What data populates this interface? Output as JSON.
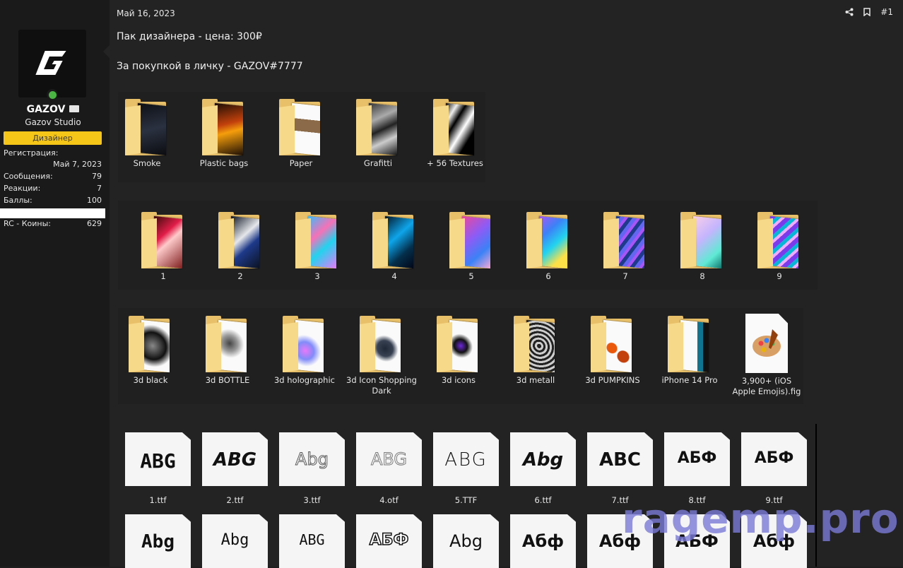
{
  "user": {
    "name": "GAZOV",
    "studio": "Gazov Studio",
    "role": "Дизайнер",
    "stats": [
      {
        "label": "Регистрация:",
        "value": "Май 7, 2023"
      },
      {
        "label": "Сообщения:",
        "value": "79"
      },
      {
        "label": "Реакции:",
        "value": "7"
      },
      {
        "label": "Баллы:",
        "value": "100"
      },
      {
        "label": "RC - Коины:",
        "value": "629"
      }
    ]
  },
  "post": {
    "date": "Май 16, 2023",
    "number": "#1",
    "line1": "Пак дизайнера - цена: 300₽",
    "line2": "За покупкой в личку - GAZOV#7777"
  },
  "textures": [
    "Smoke",
    "Plastic bags",
    "Paper",
    "Grafitti",
    "+ 56 Textures"
  ],
  "gradients": [
    "1",
    "2",
    "3",
    "4",
    "5",
    "6",
    "7",
    "8",
    "9"
  ],
  "icons3d": [
    "3d black",
    "3d BOTTLE",
    "3d holographic",
    "3d Icon Shopping Dark",
    "3d icons",
    "3d metall",
    "3d PUMPKINS",
    "iPhone 14 Pro",
    "3,900+ (iOS Apple Emojis).fig"
  ],
  "fonts_row1": [
    {
      "name": "1.ttf",
      "sample": "ABG"
    },
    {
      "name": "2.ttf",
      "sample": "ABG"
    },
    {
      "name": "3.ttf",
      "sample": "Abg"
    },
    {
      "name": "4.otf",
      "sample": "ABG"
    },
    {
      "name": "5.TTF",
      "sample": "ABG"
    },
    {
      "name": "6.ttf",
      "sample": "Abg"
    },
    {
      "name": "7.ttf",
      "sample": "ABC"
    },
    {
      "name": "8.ttf",
      "sample": "АБФ"
    },
    {
      "name": "9.ttf",
      "sample": "АБФ"
    }
  ],
  "fonts_row2": [
    "Abg",
    "Abg",
    "ABG",
    "АБФ",
    "Abg",
    "Абф",
    "Абф",
    "АБФ",
    "Абф"
  ],
  "watermark": "ragemp.pro"
}
